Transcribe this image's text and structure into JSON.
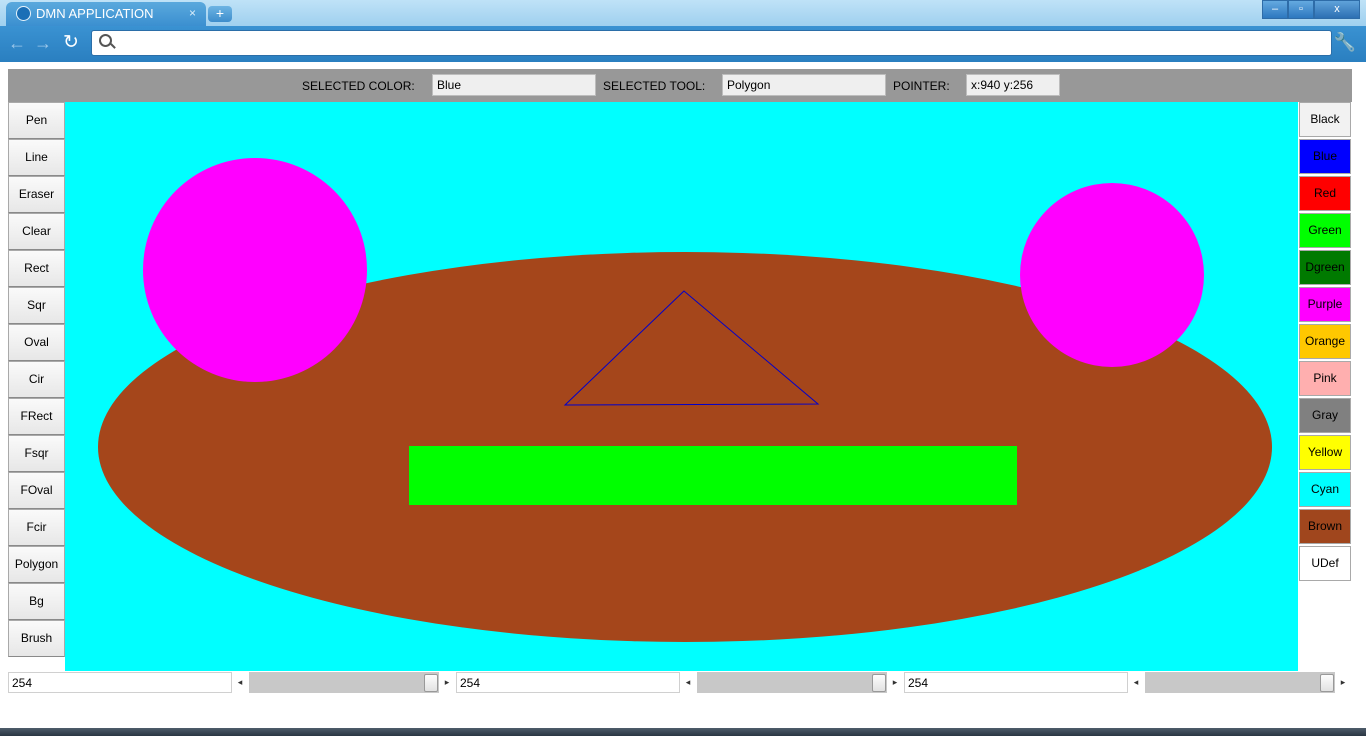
{
  "browser": {
    "tab_title": "DMN APPLICATION",
    "tab_close": "×",
    "new_tab": "+",
    "window": {
      "minimize": "–",
      "maximize": "▫",
      "close": "x"
    },
    "nav": {
      "back": "←",
      "forward": "→",
      "reload": "↻",
      "wrench": "🔧"
    },
    "address_value": ""
  },
  "header": {
    "selected_color_label": "SELECTED COLOR:",
    "selected_color_value": "Blue",
    "selected_tool_label": "SELECTED TOOL:",
    "selected_tool_value": "Polygon",
    "pointer_label": "POINTER:",
    "pointer_value": "x:940  y:256"
  },
  "tools": [
    "Pen",
    "Line",
    "Eraser",
    "Clear",
    "Rect",
    "Sqr",
    "Oval",
    "Cir",
    "FRect",
    "Fsqr",
    "FOval",
    "Fcir",
    "Polygon",
    "Bg",
    "Brush"
  ],
  "colors": [
    {
      "label": "Black",
      "bg": "#f2f2f2",
      "fg": "#000000"
    },
    {
      "label": "Blue",
      "bg": "#0000ff",
      "fg": "#000000"
    },
    {
      "label": "Red",
      "bg": "#ff0000",
      "fg": "#000000"
    },
    {
      "label": "Green",
      "bg": "#00ff00",
      "fg": "#000000"
    },
    {
      "label": "Dgreen",
      "bg": "#007a00",
      "fg": "#000000"
    },
    {
      "label": "Purple",
      "bg": "#ff00ff",
      "fg": "#000000"
    },
    {
      "label": "Orange",
      "bg": "#ffc800",
      "fg": "#000000"
    },
    {
      "label": "Pink",
      "bg": "#ffafaf",
      "fg": "#000000"
    },
    {
      "label": "Gray",
      "bg": "#808080",
      "fg": "#000000"
    },
    {
      "label": "Yellow",
      "bg": "#ffff00",
      "fg": "#000000"
    },
    {
      "label": "Cyan",
      "bg": "#00ffff",
      "fg": "#000000"
    },
    {
      "label": "Brown",
      "bg": "#a0461d",
      "fg": "#000000"
    },
    {
      "label": "UDef",
      "bg": "#ffffff",
      "fg": "#000000"
    }
  ],
  "sliders": [
    {
      "value": "254"
    },
    {
      "value": "254"
    },
    {
      "value": "254"
    }
  ],
  "canvas_colors": {
    "background": "#00ffff",
    "oval": "#a5461b",
    "circles": "#ff00ff",
    "rect": "#00ff00",
    "triangle_stroke": "#0000cc"
  }
}
